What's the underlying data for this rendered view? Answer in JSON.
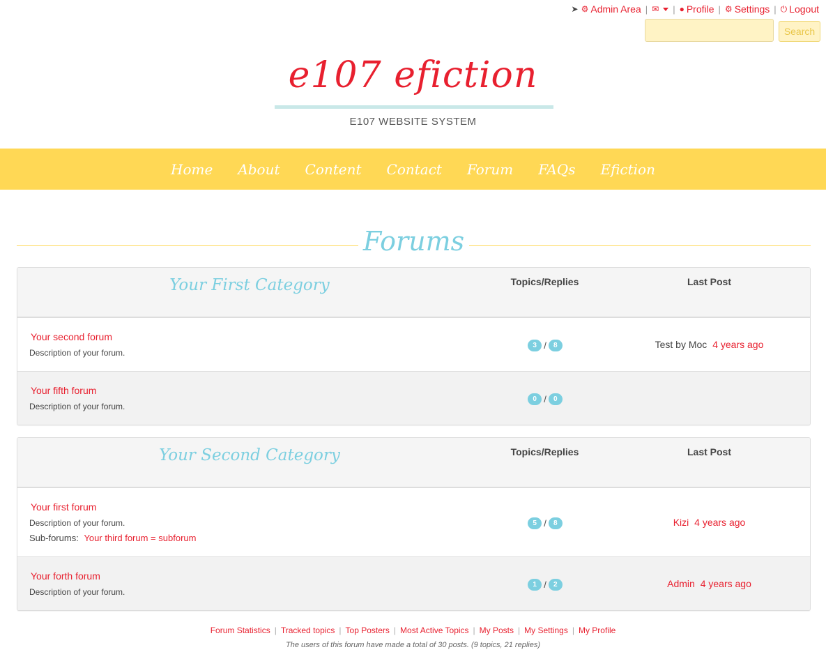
{
  "topbar": {
    "admin_area": "Admin Area",
    "profile": "Profile",
    "settings": "Settings",
    "logout": "Logout"
  },
  "search": {
    "placeholder": "",
    "button_label": "Search"
  },
  "brand": {
    "title": "e107 efiction",
    "subtitle": "E107 WEBSITE SYSTEM"
  },
  "nav": {
    "items": [
      {
        "label": "Home"
      },
      {
        "label": "About"
      },
      {
        "label": "Content"
      },
      {
        "label": "Contact"
      },
      {
        "label": "Forum"
      },
      {
        "label": "FAQs"
      },
      {
        "label": "Efiction"
      }
    ]
  },
  "page": {
    "title": "Forums"
  },
  "columns": {
    "topics_replies": "Topics/Replies",
    "last_post": "Last Post"
  },
  "categories": [
    {
      "title": "Your First Category",
      "forums": [
        {
          "name": "Your second forum",
          "description": "Description of your forum.",
          "topics": "3",
          "replies": "8",
          "last_post_prefix": "Test by Moc",
          "last_post_user": "",
          "last_post_time": "4 years ago"
        },
        {
          "name": "Your fifth forum",
          "description": "Description of your forum.",
          "topics": "0",
          "replies": "0",
          "last_post_prefix": "",
          "last_post_user": "",
          "last_post_time": ""
        }
      ]
    },
    {
      "title": "Your Second Category",
      "forums": [
        {
          "name": "Your first forum",
          "description": "Description of your forum.",
          "subforums_label": "Sub-forums:",
          "subforum": "Your third forum = subforum",
          "topics": "5",
          "replies": "8",
          "last_post_prefix": "",
          "last_post_user": "Kizi",
          "last_post_time": "4 years ago"
        },
        {
          "name": "Your forth forum",
          "description": "Description of your forum.",
          "topics": "1",
          "replies": "2",
          "last_post_prefix": "",
          "last_post_user": "Admin",
          "last_post_time": "4 years ago"
        }
      ]
    }
  ],
  "footer": {
    "links": [
      "Forum Statistics",
      "Tracked topics",
      "Top Posters",
      "Most Active Topics",
      "My Posts",
      "My Settings",
      "My Profile"
    ],
    "stats": "The users of this forum have made a total of 30 posts. (9 topics, 21 replies)"
  },
  "colors": {
    "accent_red": "#e8202f",
    "nav_yellow": "#ffd855",
    "heading_teal": "#7ccfe0"
  }
}
